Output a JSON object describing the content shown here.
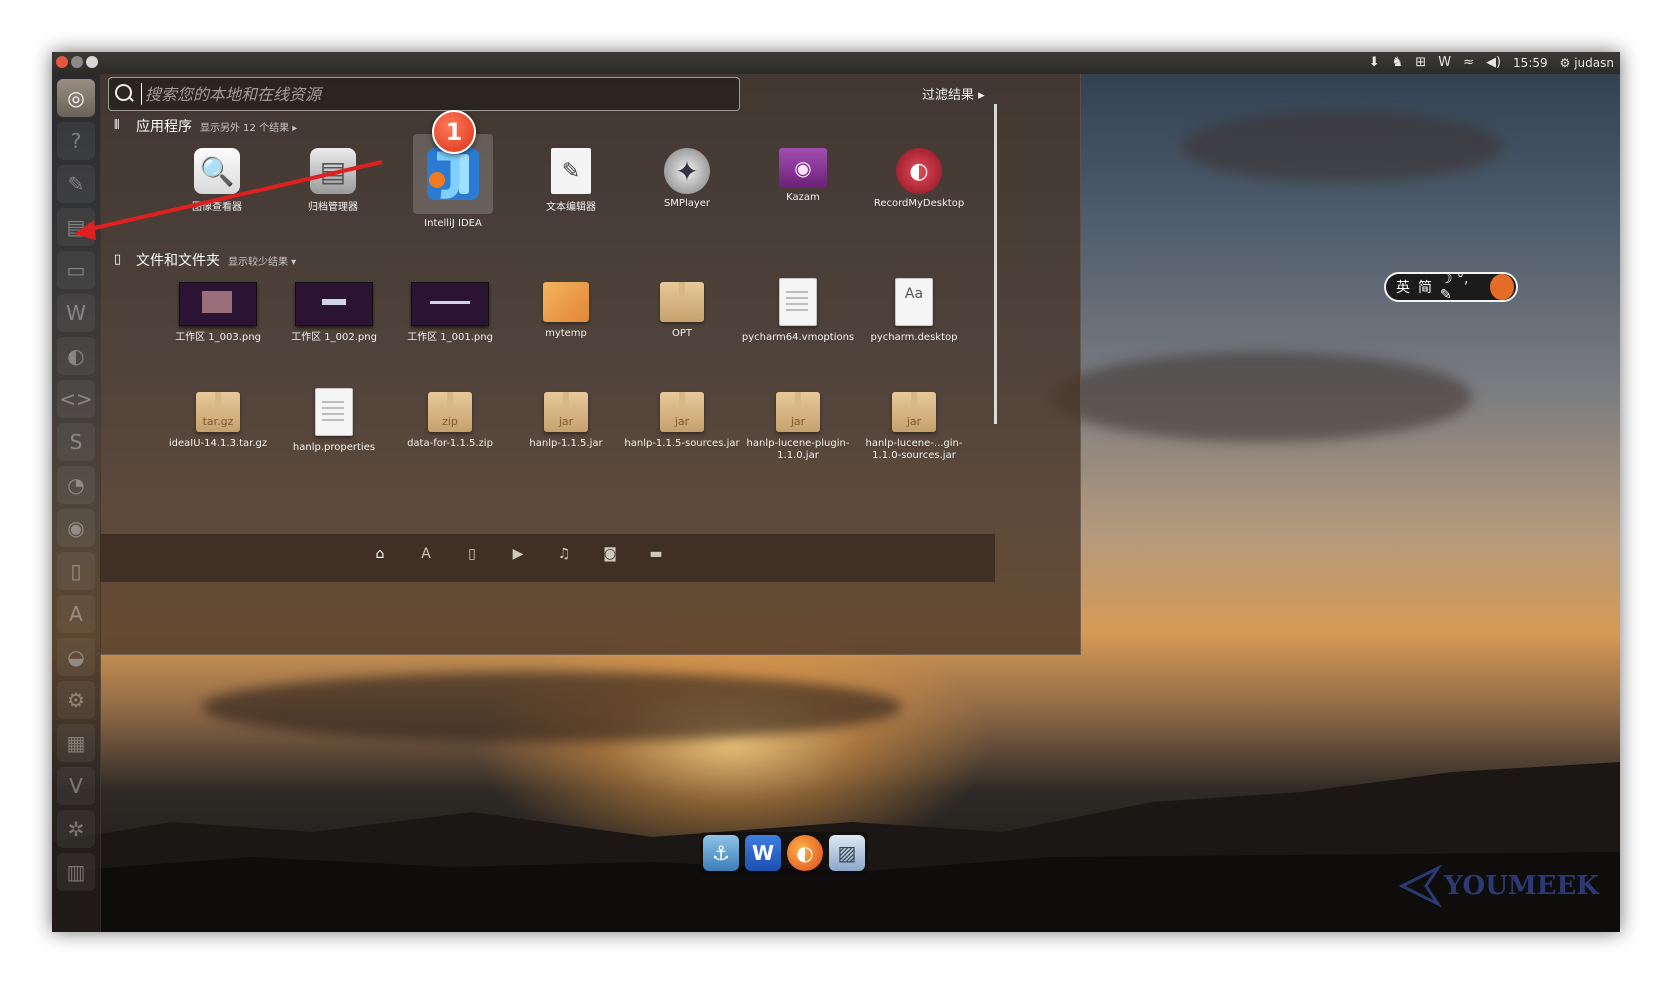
{
  "topbar": {
    "indicators": [
      "⬇",
      "♞",
      "⊞",
      "W",
      "≈",
      "◀)"
    ],
    "time": "15:59",
    "user": "judasn"
  },
  "search": {
    "placeholder": "搜索您的本地和在线资源"
  },
  "filter_label": "过滤结果 ▸",
  "apps_section": {
    "title": "应用程序",
    "more": "显示另外 12 个结果 ▸",
    "items": [
      {
        "label": "图像查看器",
        "icon": "image-viewer-icon"
      },
      {
        "label": "归档管理器",
        "icon": "archive-manager-icon"
      },
      {
        "label": "IntelliJ IDEA",
        "icon": "intellij-idea-icon"
      },
      {
        "label": "文本编辑器",
        "icon": "text-editor-icon"
      },
      {
        "label": "SMPlayer",
        "icon": "smplayer-icon"
      },
      {
        "label": "Kazam",
        "icon": "kazam-icon"
      },
      {
        "label": "RecordMyDesktop",
        "icon": "recordmydesktop-icon"
      }
    ]
  },
  "badge_number": "1",
  "files_section": {
    "title": "文件和文件夹",
    "more": "显示较少结果 ▾",
    "row1": [
      {
        "label": "工作区 1_003.png",
        "type": "thumb"
      },
      {
        "label": "工作区 1_002.png",
        "type": "thumb"
      },
      {
        "label": "工作区 1_001.png",
        "type": "thumb"
      },
      {
        "label": "mytemp",
        "type": "folder"
      },
      {
        "label": "OPT",
        "type": "box"
      },
      {
        "label": "pycharm64.vmoptions",
        "type": "doc"
      },
      {
        "label": "pycharm.desktop",
        "type": "doc"
      }
    ],
    "row2": [
      {
        "label": "ideaIU-14.1.3.tar.gz",
        "type": "box",
        "tag": "tar.gz"
      },
      {
        "label": "hanlp.properties",
        "type": "doc"
      },
      {
        "label": "data-for-1.1.5.zip",
        "type": "box",
        "tag": "zip"
      },
      {
        "label": "hanlp-1.1.5.jar",
        "type": "box",
        "tag": "jar"
      },
      {
        "label": "hanlp-1.1.5-sources.jar",
        "type": "box",
        "tag": "jar"
      },
      {
        "label": "hanlp-lucene-plugin-1.1.0.jar",
        "type": "box",
        "tag": "jar"
      },
      {
        "label": "hanlp-lucene-...gin-1.1.0-sources.jar",
        "type": "box",
        "tag": "jar"
      }
    ]
  },
  "lens_bar": {
    "icons": [
      "home-lens-icon",
      "applications-lens-icon",
      "files-lens-icon",
      "video-lens-icon",
      "music-lens-icon",
      "photo-lens-icon",
      "social-lens-icon"
    ]
  },
  "ime": {
    "mode_en": "英",
    "mode_cn": "简",
    "extra": "☽ °, ✎"
  },
  "dock": [
    "anchor",
    "W",
    "firefox",
    "image"
  ],
  "watermark": "YOUMEEK"
}
